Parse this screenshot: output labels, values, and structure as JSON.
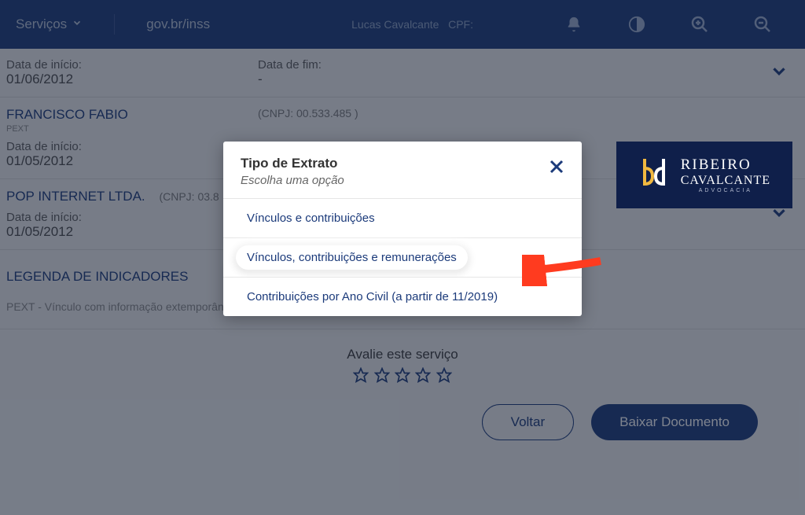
{
  "topbar": {
    "services_label": "Serviços",
    "portal_label": "gov.br/inss",
    "user_name": "Lucas Cavalcante",
    "user_cpf_label": "CPF:"
  },
  "records": [
    {
      "start_label": "Data de início:",
      "start_value": "01/06/2012",
      "end_label": "Data de fim:",
      "end_value": "-"
    },
    {
      "company": "FRANCISCO FABIO",
      "sub": "PEXT",
      "cnpj": "(CNPJ: 00.533.485 )",
      "start_label": "Data de início:",
      "start_value": "01/05/2012"
    },
    {
      "company": "POP INTERNET LTDA.",
      "cnpj": "(CNPJ: 03.8",
      "start_label": "Data de início:",
      "start_value": "01/05/2012"
    }
  ],
  "legenda": {
    "title": "LEGENDA DE INDICADORES",
    "text": "PEXT - Vínculo com informação extemporânea, passível de comprovação"
  },
  "rating": {
    "title": "Avalie este serviço"
  },
  "buttons": {
    "back": "Voltar",
    "download": "Baixar Documento"
  },
  "modal": {
    "title": "Tipo de Extrato",
    "subtitle": "Escolha uma opção",
    "options": [
      "Vínculos e contribuições",
      "Vínculos, contribuições e remunerações",
      "Contribuições por Ano Civil (a partir de 11/2019)"
    ]
  },
  "brand": {
    "line1": "RIBEIRO",
    "line2": "CAVALCANTE",
    "line3": "ADVOCACIA"
  }
}
